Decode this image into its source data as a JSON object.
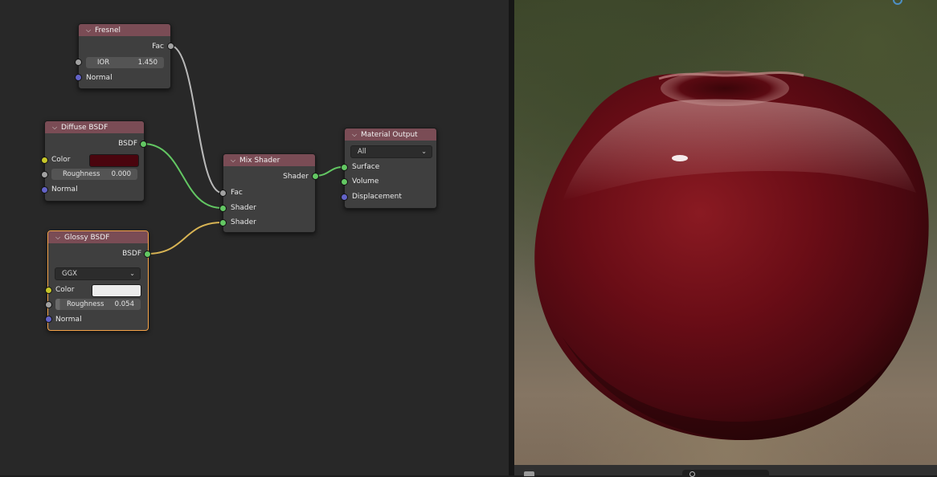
{
  "nodes": {
    "fresnel": {
      "title": "Fresnel",
      "output_fac": "Fac",
      "ior_label": "IOR",
      "ior_value": "1.450",
      "normal": "Normal"
    },
    "diffuse": {
      "title": "Diffuse BSDF",
      "output_bsdf": "BSDF",
      "color_label": "Color",
      "color_value": "#4a050e",
      "roughness_label": "Roughness",
      "roughness_value": "0.000",
      "normal": "Normal"
    },
    "glossy": {
      "title": "Glossy BSDF",
      "output_bsdf": "BSDF",
      "distribution": "GGX",
      "color_label": "Color",
      "color_value": "#ececec",
      "roughness_label": "Roughness",
      "roughness_value": "0.054",
      "normal": "Normal"
    },
    "mix": {
      "title": "Mix Shader",
      "output_shader": "Shader",
      "input_fac": "Fac",
      "input_shader_1": "Shader",
      "input_shader_2": "Shader"
    },
    "output": {
      "title": "Material Output",
      "target": "All",
      "surface": "Surface",
      "volume": "Volume",
      "displacement": "Displacement"
    }
  },
  "colors": {
    "header": "#7a4c55",
    "socket_shader": "#63c763",
    "socket_float": "#a1a1a1",
    "socket_vector": "#6363c7",
    "socket_color": "#c7c729",
    "selected_outline": "#f5a349",
    "link_selected": "#d8b454"
  },
  "icons": {
    "collapse": "chevron-down-icon",
    "dropdown": "chevron-down-icon",
    "editor_type": "editor-type-icon",
    "search": "search-icon",
    "viewport_gizmo": "gizmo-icon"
  }
}
